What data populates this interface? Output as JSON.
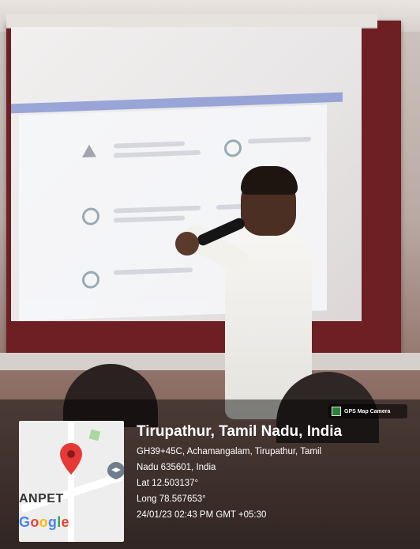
{
  "badge": {
    "label": "GPS Map Camera",
    "icon": "gps-map-camera-icon"
  },
  "map": {
    "area_label": "ANPET",
    "logo_text": [
      "G",
      "o",
      "o",
      "g",
      "l",
      "e"
    ],
    "pin_icon": "map-pin-icon",
    "edge_icon": "school-marker-icon",
    "colors": {
      "pin": "#E53935",
      "google_blue": "#4285F4",
      "google_red": "#EA4335",
      "google_yellow": "#FBBC05",
      "google_green": "#34A853"
    }
  },
  "location": {
    "title": "Tirupathur, Tamil Nadu, India",
    "address_line1": "GH39+45C, Achamangalam, Tirupathur, Tamil",
    "address_line2": "Nadu 635601, India",
    "lat": "Lat 12.503137°",
    "long": "Long 78.567653°",
    "timestamp": "24/01/23 02:43 PM GMT +05:30"
  }
}
